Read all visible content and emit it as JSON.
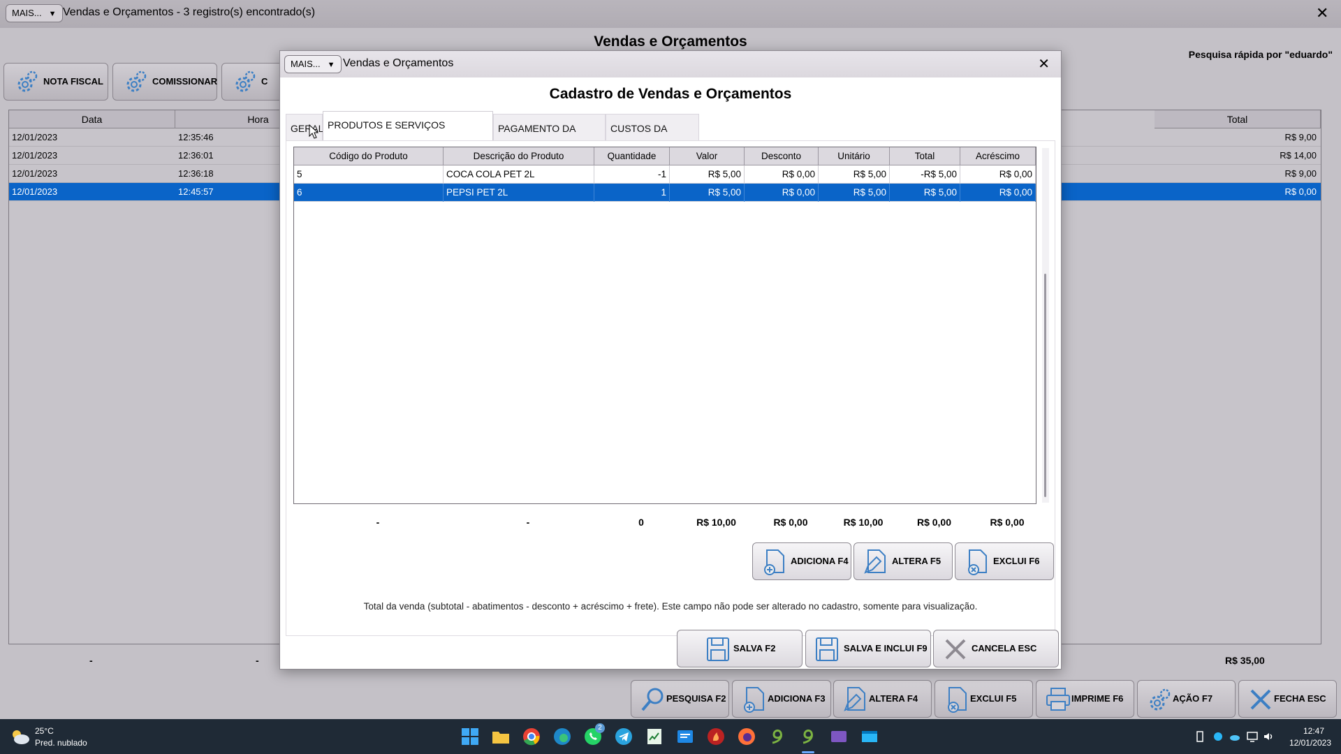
{
  "main": {
    "mais_label": "MAIS...",
    "mais_arrow": "▼",
    "title": "Vendas e Orçamentos - 3 registro(s) encontrado(s)",
    "close_glyph": "✕",
    "heading": "Vendas e Orçamentos",
    "quick_search": "Pesquisa rápida por \"eduardo\"",
    "action_buttons": [
      "NOTA FISCAL",
      "COMISSIONAR",
      "C"
    ],
    "grid": {
      "headers": [
        "Data",
        "Hora",
        "Total"
      ],
      "rows": [
        {
          "data": "12/01/2023",
          "hora": "12:35:46",
          "total": "R$ 9,00"
        },
        {
          "data": "12/01/2023",
          "hora": "12:36:01",
          "total": "R$ 14,00"
        },
        {
          "data": "12/01/2023",
          "hora": "12:36:18",
          "total": "R$ 9,00"
        },
        {
          "data": "12/01/2023",
          "hora": "12:45:57",
          "total": "R$ 0,00"
        }
      ],
      "footer": {
        "data": "-",
        "hora": "-",
        "total": "R$ 35,00"
      }
    },
    "footer_buttons": [
      "PESQUISA F2",
      "ADICIONA F3",
      "ALTERA F4",
      "EXCLUI F5",
      "IMPRIME F6",
      "AÇÃO F7",
      "FECHA ESC"
    ]
  },
  "dialog": {
    "mais_label": "MAIS...",
    "mais_arrow": "▼",
    "title": "Vendas e Orçamentos",
    "close_glyph": "✕",
    "heading": "Cadastro de Vendas e Orçamentos",
    "tabs": [
      "GERAL",
      "PRODUTOS E SERVIÇOS VENDIDOS",
      "PAGAMENTO DA VENDA",
      "CUSTOS DA VENDA"
    ],
    "active_tab": "PRODUTOS E SERVIÇOS VENDIDOS",
    "grid": {
      "headers": [
        "Código do Produto",
        "Descrição do Produto",
        "Quantidade",
        "Valor",
        "Desconto",
        "Unitário",
        "Total",
        "Acréscimo"
      ],
      "rows": [
        {
          "codigo": "5",
          "descricao": "COCA COLA PET 2L",
          "quantidade": "-1",
          "valor": "R$ 5,00",
          "desconto": "R$ 0,00",
          "unitario": "R$ 5,00",
          "total": "-R$ 5,00",
          "acrescimo": "R$ 0,00"
        },
        {
          "codigo": "6",
          "descricao": "PEPSI PET 2L",
          "quantidade": "1",
          "valor": "R$ 5,00",
          "desconto": "R$ 0,00",
          "unitario": "R$ 5,00",
          "total": "R$ 5,00",
          "acrescimo": "R$ 0,00"
        }
      ],
      "selected_row": 1,
      "totals": {
        "codigo": "-",
        "descricao": "-",
        "quantidade": "0",
        "valor": "R$ 10,00",
        "desconto": "R$ 0,00",
        "unitario": "R$ 10,00",
        "total": "R$ 0,00",
        "acrescimo": "R$ 0,00"
      }
    },
    "item_buttons": [
      "ADICIONA F4",
      "ALTERA F5",
      "EXCLUI F6"
    ],
    "info_text": "Total da venda (subtotal - abatimentos - desconto + acréscimo + frete). Este campo não pode ser alterado no cadastro, somente para visualização.",
    "footer_buttons": [
      "SALVA F2",
      "SALVA E INCLUI F9",
      "CANCELA ESC"
    ]
  },
  "taskbar": {
    "weather_temp": "25°C",
    "weather_desc": "Pred. nublado",
    "whatsapp_badge": "2",
    "time": "12:47",
    "date": "12/01/2023"
  },
  "colors": {
    "selection": "#0a64c8",
    "taskbar": "#1f2a36",
    "dim_background": "#c4c1c7"
  }
}
